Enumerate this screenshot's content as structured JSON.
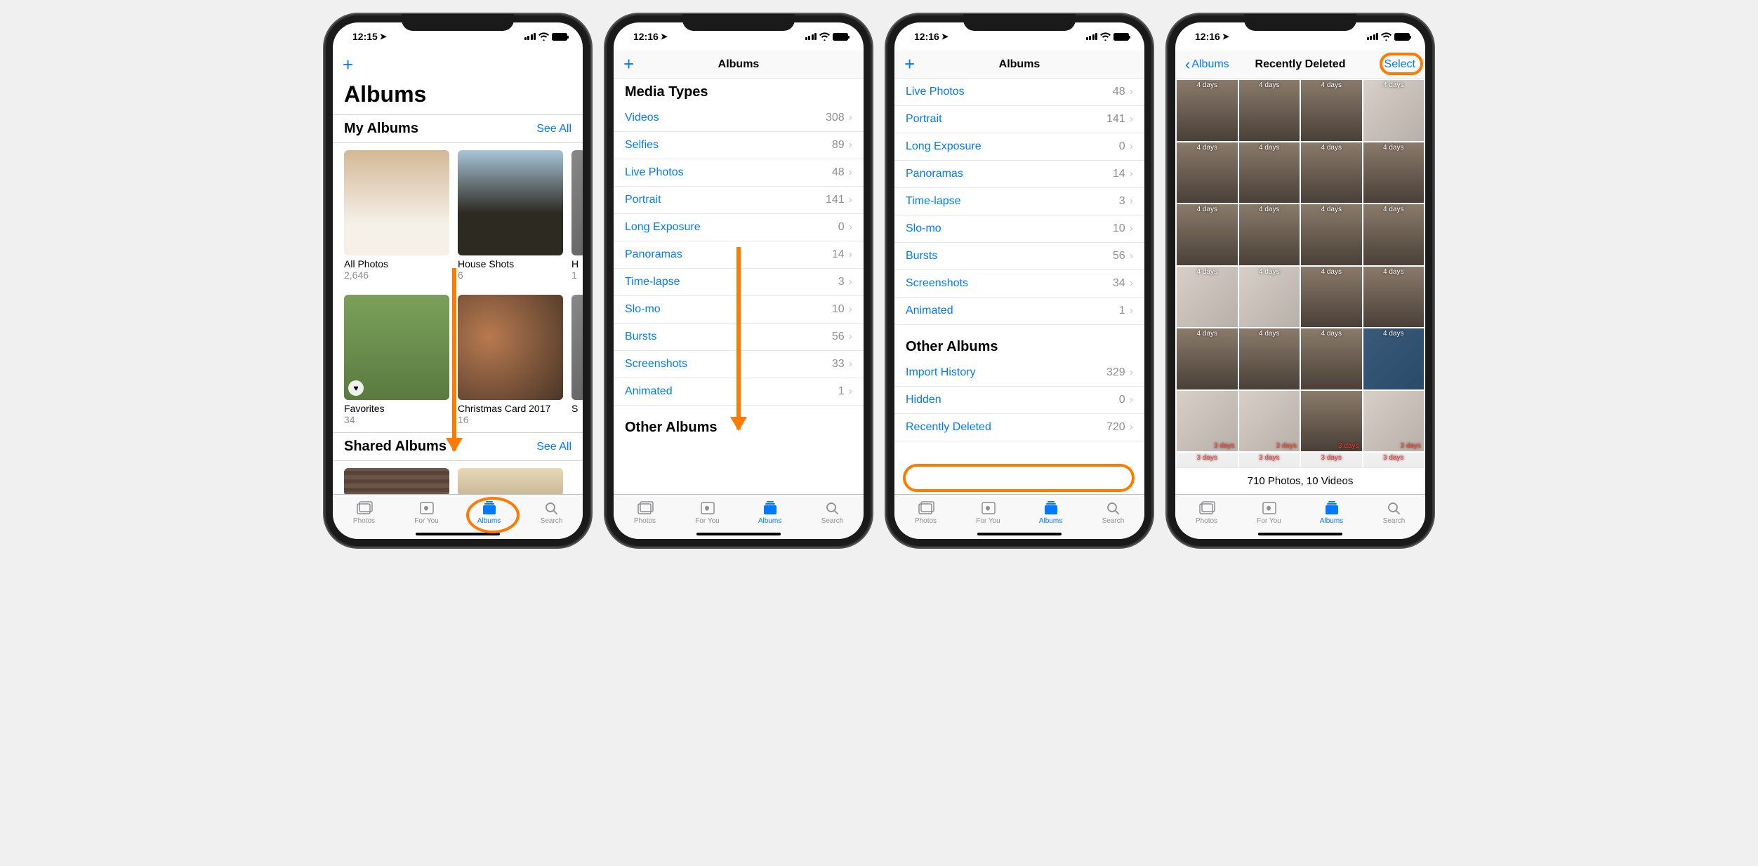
{
  "screen1": {
    "time": "12:15",
    "large_title": "Albums",
    "my_albums": {
      "title": "My Albums",
      "see_all": "See All",
      "items": [
        {
          "name": "All Photos",
          "count": "2,646"
        },
        {
          "name": "House Shots",
          "count": "6"
        },
        {
          "name": "H",
          "count": "1"
        },
        {
          "name": "Favorites",
          "count": "34"
        },
        {
          "name": "Christmas Card 2017",
          "count": "16"
        },
        {
          "name": "S",
          "count": ""
        }
      ]
    },
    "shared_albums": {
      "title": "Shared Albums",
      "see_all": "See All"
    }
  },
  "screen2": {
    "time": "12:16",
    "nav_title": "Albums",
    "media_types_title": "Media Types",
    "media_types": [
      {
        "label": "Videos",
        "count": "308"
      },
      {
        "label": "Selfies",
        "count": "89"
      },
      {
        "label": "Live Photos",
        "count": "48"
      },
      {
        "label": "Portrait",
        "count": "141"
      },
      {
        "label": "Long Exposure",
        "count": "0"
      },
      {
        "label": "Panoramas",
        "count": "14"
      },
      {
        "label": "Time-lapse",
        "count": "3"
      },
      {
        "label": "Slo-mo",
        "count": "10"
      },
      {
        "label": "Bursts",
        "count": "56"
      },
      {
        "label": "Screenshots",
        "count": "33"
      },
      {
        "label": "Animated",
        "count": "1"
      }
    ],
    "other_albums_title": "Other Albums"
  },
  "screen3": {
    "time": "12:16",
    "nav_title": "Albums",
    "media_types": [
      {
        "label": "Live Photos",
        "count": "48"
      },
      {
        "label": "Portrait",
        "count": "141"
      },
      {
        "label": "Long Exposure",
        "count": "0"
      },
      {
        "label": "Panoramas",
        "count": "14"
      },
      {
        "label": "Time-lapse",
        "count": "3"
      },
      {
        "label": "Slo-mo",
        "count": "10"
      },
      {
        "label": "Bursts",
        "count": "56"
      },
      {
        "label": "Screenshots",
        "count": "34"
      },
      {
        "label": "Animated",
        "count": "1"
      }
    ],
    "other_albums_title": "Other Albums",
    "other_albums": [
      {
        "label": "Import History",
        "count": "329"
      },
      {
        "label": "Hidden",
        "count": "0"
      },
      {
        "label": "Recently Deleted",
        "count": "720"
      }
    ]
  },
  "screen4": {
    "time": "12:16",
    "back_label": "Albums",
    "nav_title": "Recently Deleted",
    "select_label": "Select",
    "summary": "710 Photos, 10 Videos",
    "overlays": {
      "d4": "4 days",
      "d3": "3 days"
    }
  },
  "tabs": {
    "photos": "Photos",
    "for_you": "For You",
    "albums": "Albums",
    "search": "Search"
  }
}
